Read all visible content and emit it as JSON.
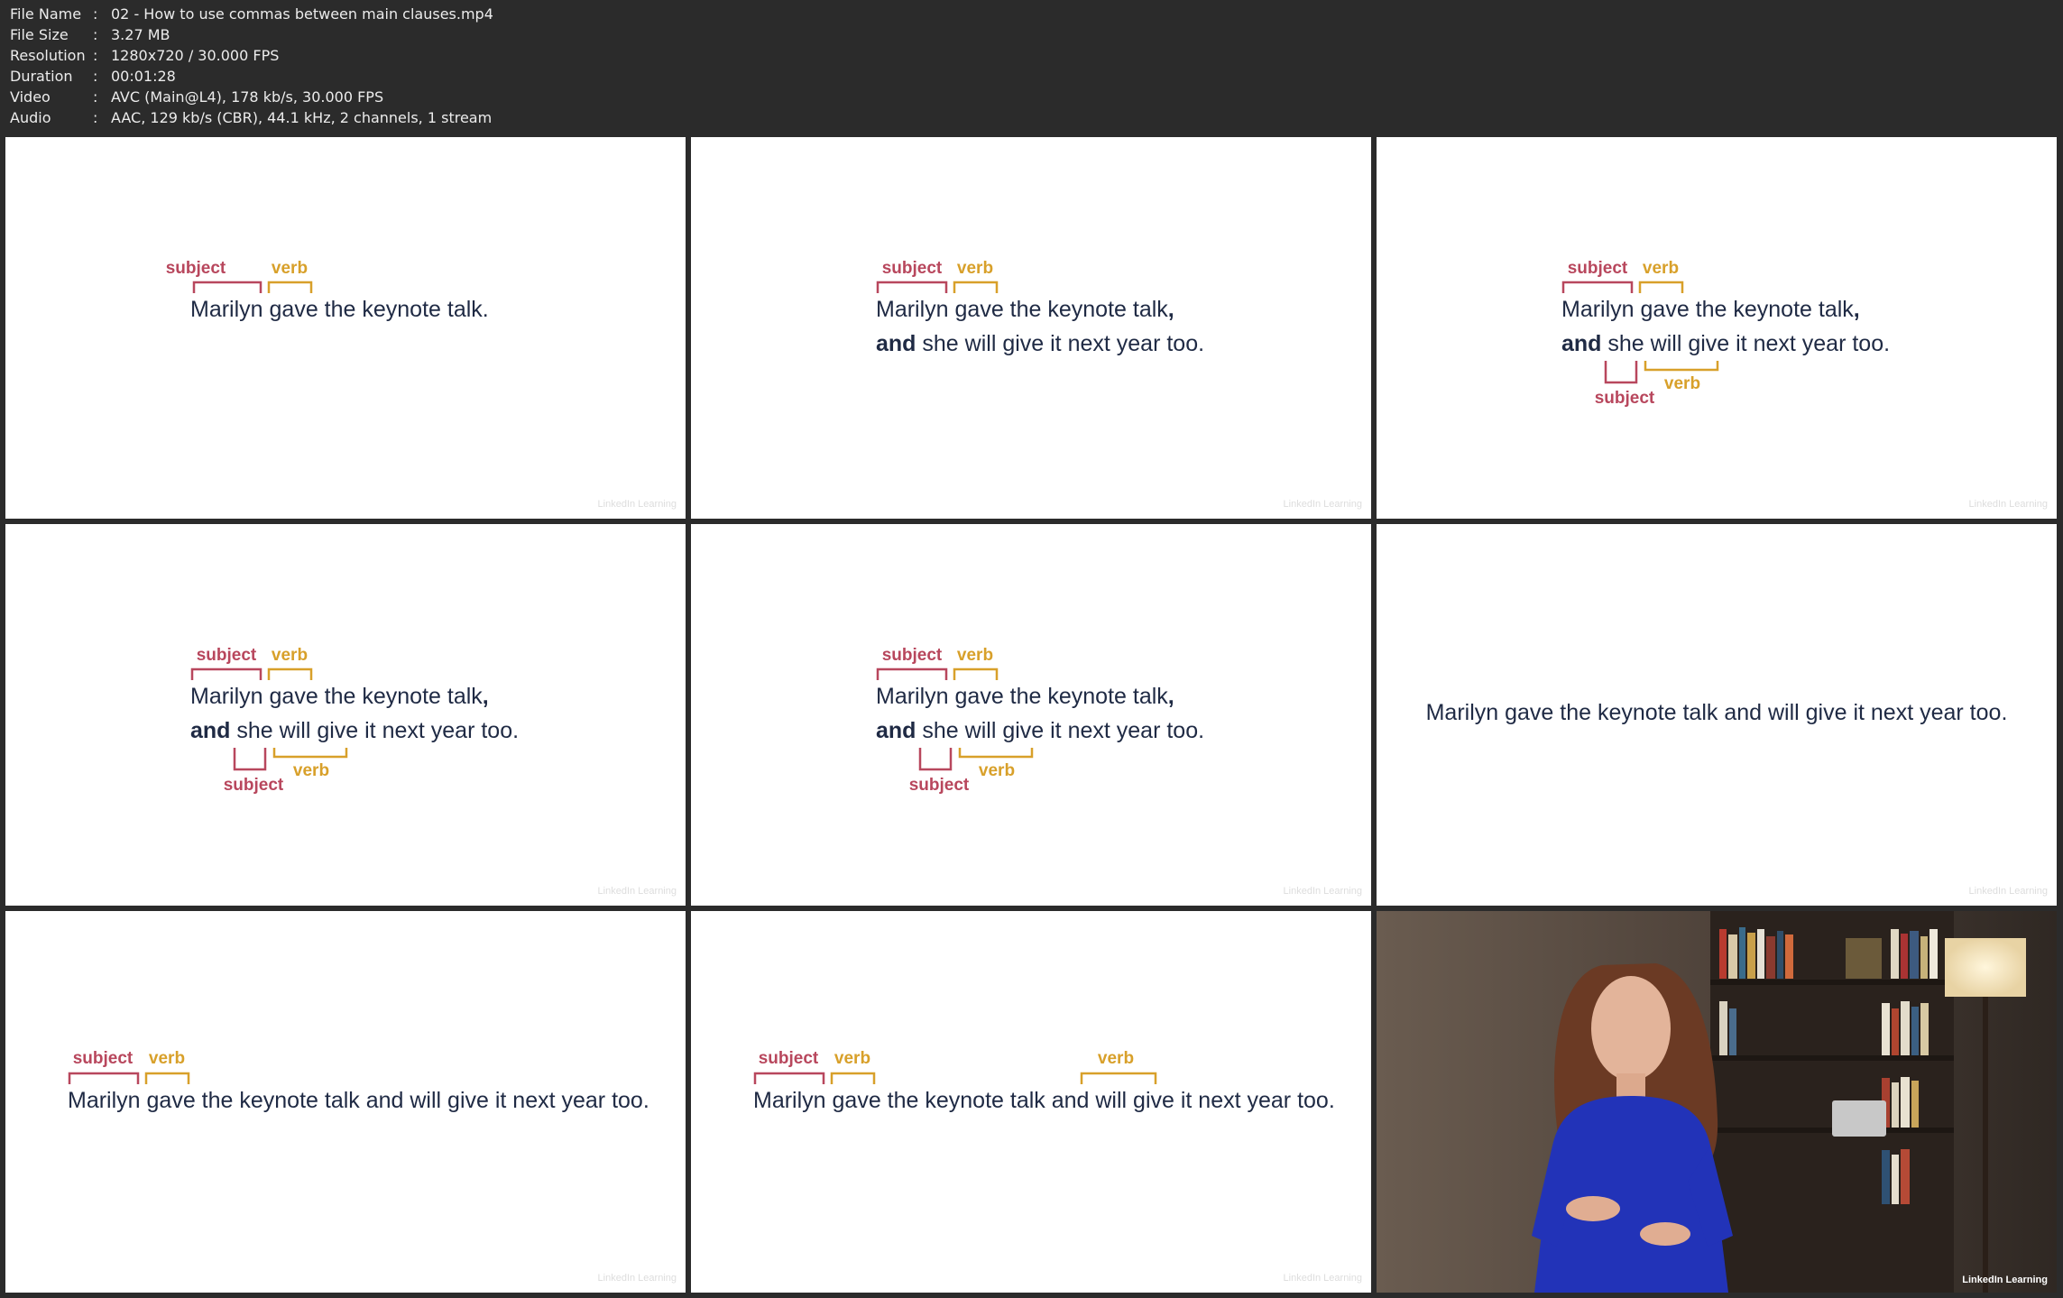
{
  "info": {
    "rows": [
      {
        "key": "File Name",
        "value": "02 - How to use commas between main clauses.mp4"
      },
      {
        "key": "File Size",
        "value": "3.27 MB"
      },
      {
        "key": "Resolution",
        "value": "1280x720 / 30.000 FPS"
      },
      {
        "key": "Duration",
        "value": "00:01:28"
      },
      {
        "key": "Video",
        "value": "AVC (Main@L4), 178 kb/s, 30.000 FPS"
      },
      {
        "key": "Audio",
        "value": "AAC, 129 kb/s (CBR), 44.1 kHz, 2 channels, 1 stream"
      }
    ]
  },
  "labels": {
    "subject": "subject",
    "verb": "verb"
  },
  "sentences": {
    "first_clause": "Marilyn gave the keynote talk.",
    "first_clause_comma": "Marilyn gave the keynote talk",
    "comma": ",",
    "conj": "and",
    "second_clause": " she will give it next year too.",
    "compound_predicate": "Marilyn gave the keynote talk and will give it next year too."
  },
  "watermark": "LinkedIn Learning",
  "colors": {
    "subject": "#b8475d",
    "verb": "#d8a02a",
    "text": "#1f2a44",
    "background": "#2b2b2b"
  }
}
